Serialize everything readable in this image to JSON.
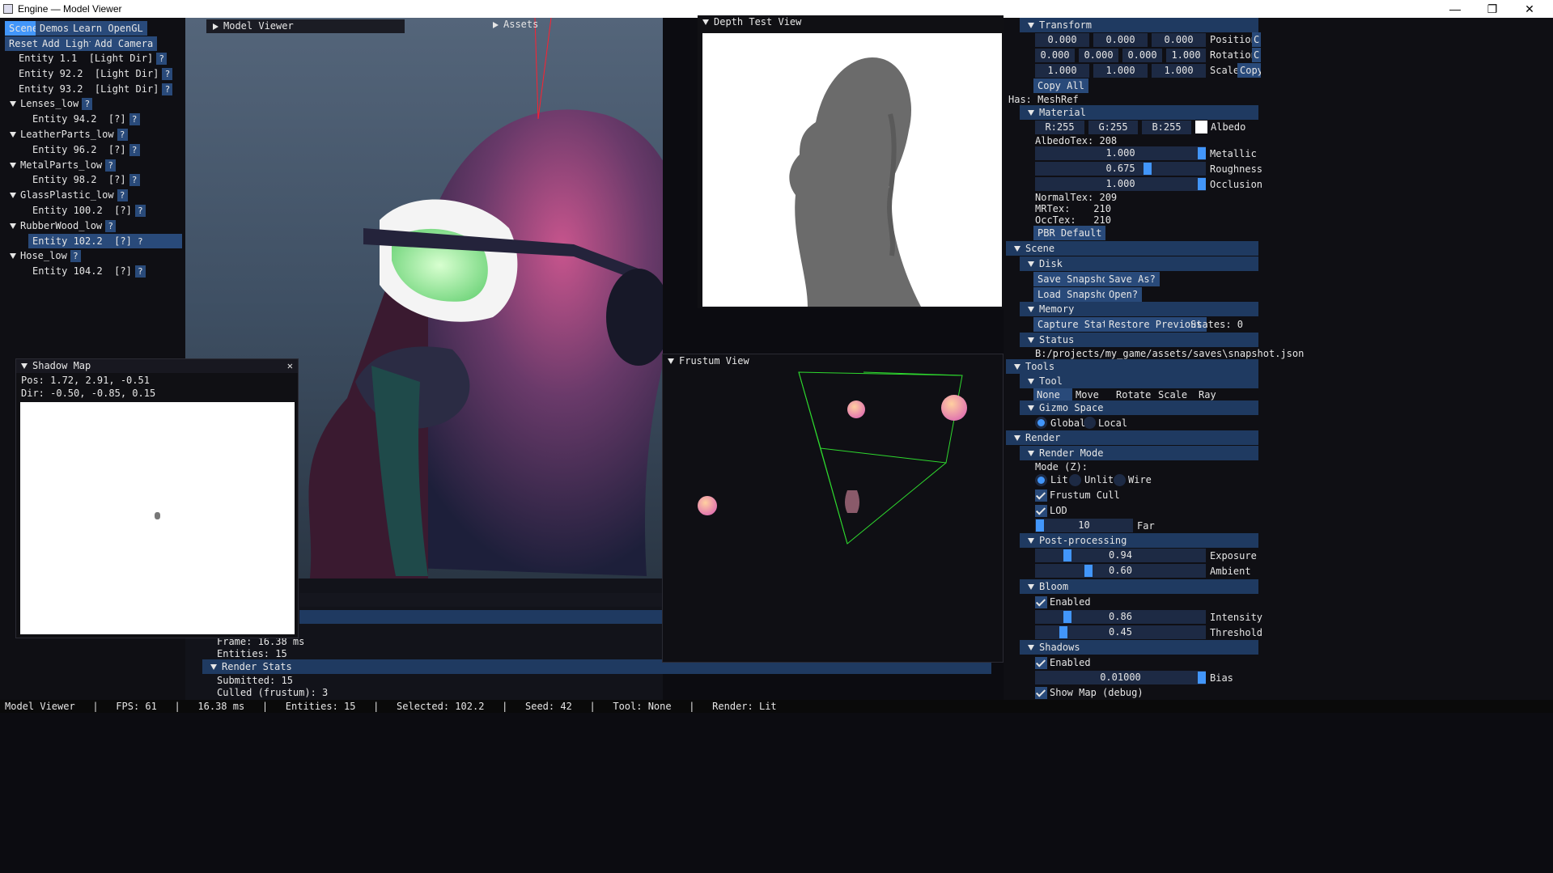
{
  "window": {
    "title": "Engine — Model Viewer",
    "min": "—",
    "max": "❐",
    "close": "✕"
  },
  "menu": {
    "tabs": [
      "Scene",
      "Demos",
      "Learn OpenGL"
    ],
    "actions": [
      "Reset",
      "Add Light",
      "Add Camera"
    ]
  },
  "hierarchy": [
    {
      "label": "Entity 1.1  [Light Dir]",
      "indent": 1
    },
    {
      "label": "Entity 92.2  [Light Dir]",
      "indent": 1
    },
    {
      "label": "Entity 93.2  [Light Dir]",
      "indent": 1
    },
    {
      "label": "Lenses_low",
      "indent": 0,
      "group": true
    },
    {
      "label": "Entity 94.2  [?]",
      "indent": 2
    },
    {
      "label": "LeatherParts_low",
      "indent": 0,
      "group": true
    },
    {
      "label": "Entity 96.2  [?]",
      "indent": 2
    },
    {
      "label": "MetalParts_low",
      "indent": 0,
      "group": true
    },
    {
      "label": "Entity 98.2  [?]",
      "indent": 2
    },
    {
      "label": "GlassPlastic_low",
      "indent": 0,
      "group": true
    },
    {
      "label": "Entity 100.2  [?]",
      "indent": 2
    },
    {
      "label": "RubberWood_low",
      "indent": 0,
      "group": true
    },
    {
      "label": "Entity 102.2  [?]",
      "indent": 2,
      "selected": true
    },
    {
      "label": "Hose_low",
      "indent": 0,
      "group": true
    },
    {
      "label": "Entity 104.2  [?]",
      "indent": 2
    }
  ],
  "help_mark": "?",
  "viewport": {
    "model_viewer_title": "Model Viewer",
    "assets_title": "Assets"
  },
  "shadow_map": {
    "title": "Shadow Map",
    "close": "✕",
    "pos": "Pos: 1.72, 2.91, -0.51",
    "dir": "Dir: -0.50, -0.85, 0.15"
  },
  "depth_view": {
    "title": "Depth Test View"
  },
  "frustum_view": {
    "title": "Frustum View"
  },
  "stats": {
    "frame": "Frame: 16.38 ms",
    "entities": "Entities: 15",
    "render_stats_title": "Render Stats",
    "submitted": "Submitted: 15",
    "culled": "Culled (frustum): 3"
  },
  "inspector": {
    "transform_title": "Transform",
    "position": [
      "0.000",
      "0.000",
      "0.000"
    ],
    "position_label": "Position",
    "position_btn": "C",
    "rotation": [
      "0.000",
      "0.000",
      "0.000",
      "1.000"
    ],
    "rotation_label": "Rotation",
    "rotation_btn": "C",
    "scale": [
      "1.000",
      "1.000",
      "1.000"
    ],
    "scale_label": "Scale",
    "scale_btn": "Copy",
    "copy_all": "Copy All",
    "has": "Has: MeshRef",
    "material_title": "Material",
    "rgb": [
      "R:255",
      "G:255",
      "B:255"
    ],
    "albedo_label": "Albedo",
    "albedo_color": "#ffffff",
    "albedo_tex": "AlbedoTex: 208",
    "metallic": {
      "value": "1.000",
      "label": "Metallic",
      "frac": 1.0
    },
    "roughness": {
      "value": "0.675",
      "label": "Roughness",
      "frac": 0.675
    },
    "occlusion": {
      "value": "1.000",
      "label": "Occlusion",
      "frac": 1.0
    },
    "normal_tex": "NormalTex: 209",
    "mr_tex": "MRTex:    210",
    "occ_tex": "OccTex:   210",
    "pbr_default": "PBR Default",
    "scene_title": "Scene",
    "disk_title": "Disk",
    "save_snapshot": "Save Snapshot",
    "save_as": "Save As?",
    "load_snapshot": "Load Snapshot",
    "open": "Open?",
    "memory_title": "Memory",
    "capture_state": "Capture State",
    "restore_previous": "Restore Previous",
    "states": "States: 0",
    "status_title": "Status",
    "status_path": "B:/projects/my_game/assets/saves\\snapshot.json",
    "tools_title": "Tools",
    "tool_title": "Tool",
    "tool_options": [
      "None",
      "Move",
      "Rotate",
      "Scale",
      "Ray"
    ],
    "tool_selected": "None",
    "gizmo_title": "Gizmo Space",
    "gizmo_options": [
      "Global",
      "Local"
    ],
    "gizmo_selected": "Global",
    "render_title": "Render",
    "render_mode_title": "Render Mode",
    "mode_label": "Mode (Z):",
    "mode_options": [
      "Lit",
      "Unlit",
      "Wire"
    ],
    "mode_selected": "Lit",
    "frustum_cull": "Frustum Cull",
    "lod": "LOD",
    "far": {
      "value": "10",
      "label": "Far",
      "frac": 0.0
    },
    "post_title": "Post-processing",
    "exposure": {
      "value": "0.94",
      "label": "Exposure",
      "frac": 0.18
    },
    "ambient": {
      "value": "0.60",
      "label": "Ambient",
      "frac": 0.3
    },
    "bloom_title": "Bloom",
    "bloom_enabled": "Enabled",
    "intensity": {
      "value": "0.86",
      "label": "Intensity",
      "frac": 0.18
    },
    "threshold": {
      "value": "0.45",
      "label": "Threshold",
      "frac": 0.15
    },
    "shadows_title": "Shadows",
    "shadows_enabled": "Enabled",
    "bias": {
      "value": "0.01000",
      "label": "Bias",
      "frac": 1.0
    },
    "show_map": "Show Map (debug)"
  },
  "statusbar": "Model Viewer   |   FPS: 61   |   16.38 ms   |   Entities: 15   |   Selected: 102.2   |   Seed: 42   |   Tool: None   |   Render: Lit"
}
